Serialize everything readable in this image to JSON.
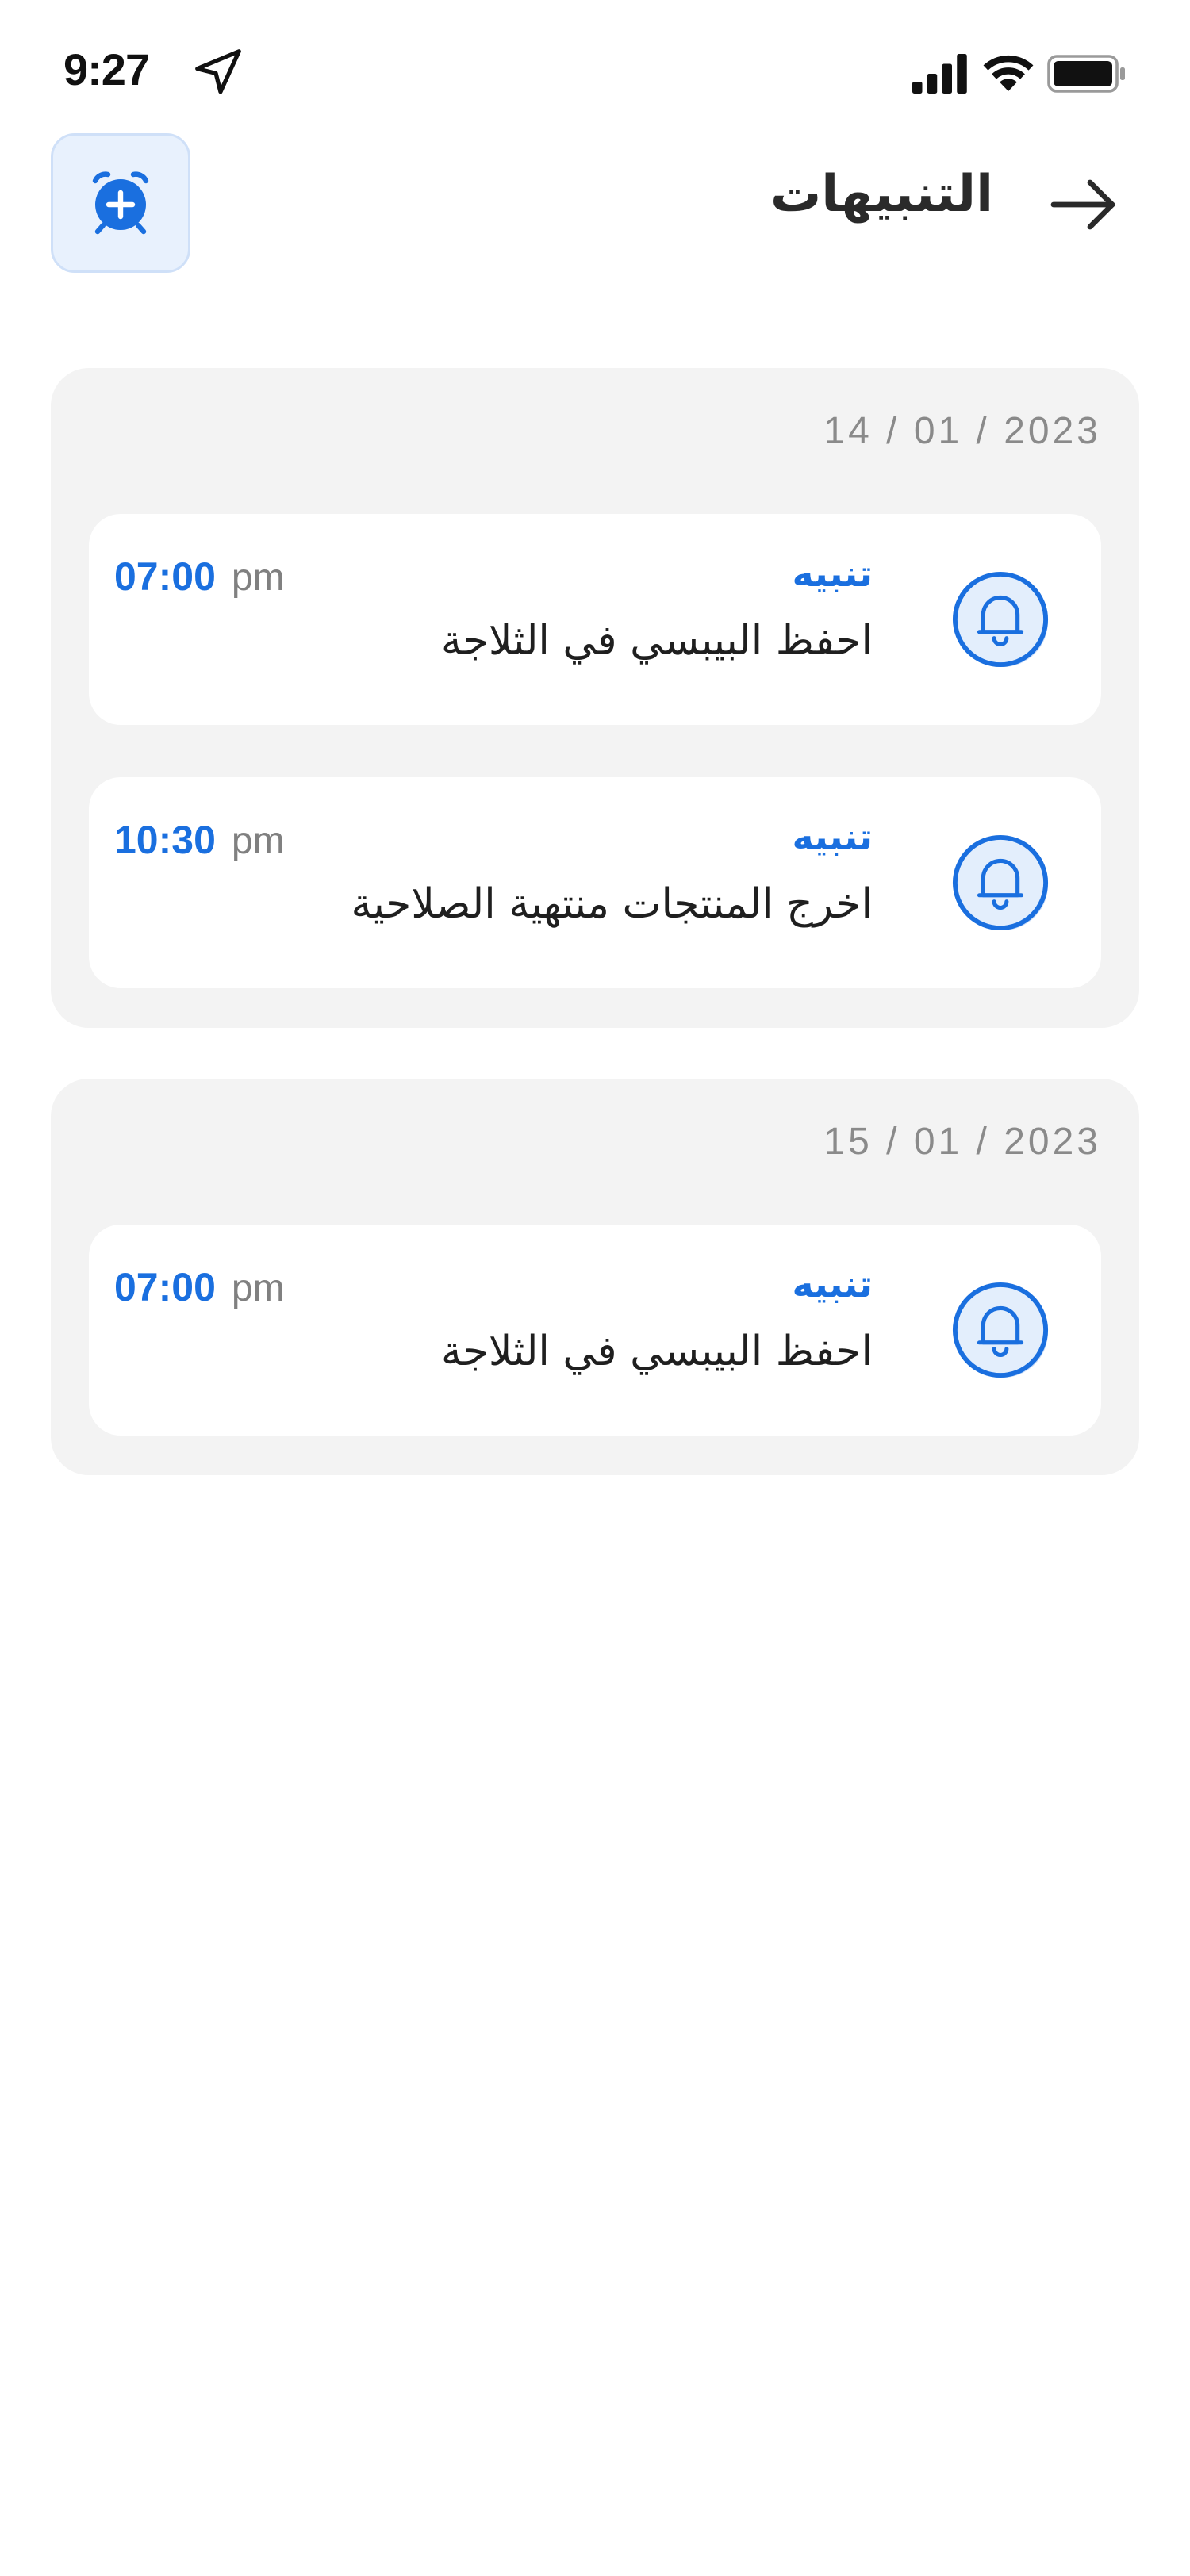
{
  "status_bar": {
    "time": "9:27",
    "icons": [
      "location-arrow-icon",
      "cellular-signal-icon",
      "wifi-icon",
      "battery-icon"
    ]
  },
  "header": {
    "title": "التنبيهات",
    "add_button_icon": "alarm-add-icon",
    "back_icon": "arrow-right-icon"
  },
  "colors": {
    "accent": "#1a6fdf",
    "group_bg": "#f3f3f3",
    "card_bg": "#ffffff",
    "icon_bg": "#e3eefc"
  },
  "groups": [
    {
      "date": "14 / 01 / 2023",
      "alerts": [
        {
          "label": "تنبيه",
          "message": "احفظ البيبسي في الثلاجة",
          "time": "07:00",
          "period": "pm",
          "icon": "bell-icon"
        },
        {
          "label": "تنبيه",
          "message": "اخرج المنتجات منتهية الصلاحية",
          "time": "10:30",
          "period": "pm",
          "icon": "bell-icon"
        }
      ]
    },
    {
      "date": "15 / 01 / 2023",
      "alerts": [
        {
          "label": "تنبيه",
          "message": "احفظ البيبسي في الثلاجة",
          "time": "07:00",
          "period": "pm",
          "icon": "bell-icon"
        }
      ]
    }
  ]
}
